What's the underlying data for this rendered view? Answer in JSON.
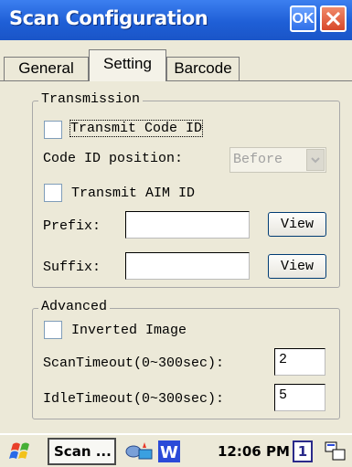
{
  "window": {
    "title": "Scan Configuration",
    "ok_label": "OK"
  },
  "tabs": [
    {
      "label": "General"
    },
    {
      "label": "Setting",
      "active": true
    },
    {
      "label": "Barcode"
    }
  ],
  "transmission": {
    "group_label": "Transmission",
    "transmit_code_id_label": "Transmit Code ID",
    "transmit_code_id_checked": false,
    "code_id_position_label": "Code ID position:",
    "code_id_position_value": "Before",
    "transmit_aim_id_label": "Transmit AIM ID",
    "transmit_aim_id_checked": false,
    "prefix_label": "Prefix:",
    "prefix_value": "",
    "prefix_view_label": "View",
    "suffix_label": "Suffix:",
    "suffix_value": "",
    "suffix_view_label": "View"
  },
  "advanced": {
    "group_label": "Advanced",
    "inverted_image_label": "Inverted Image",
    "inverted_image_checked": false,
    "scan_timeout_label": "ScanTimeout(0~300sec):",
    "scan_timeout_value": "2",
    "idle_timeout_label": "IdleTimeout(0~300sec):",
    "idle_timeout_value": "5"
  },
  "taskbar": {
    "task_label": "Scan ...",
    "time": "12:06 PM",
    "input_indicator": "1",
    "icons": [
      "start-flag-icon",
      "connectivity-icon",
      "word-icon",
      "input-panel-icon"
    ]
  },
  "colors": {
    "titlebar": "#1F5FD6",
    "dialog_bg": "#ECE9D8",
    "close": "#D8482A"
  }
}
